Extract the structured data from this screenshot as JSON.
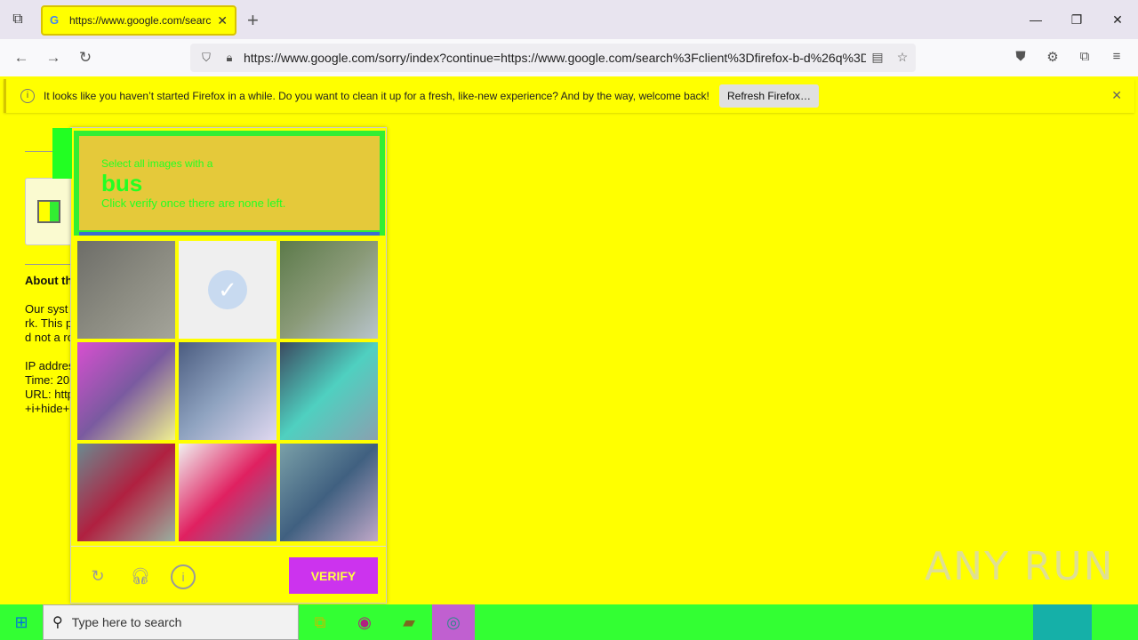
{
  "browser": {
    "tab": {
      "title": "https://www.google.com/search?",
      "favicon_icon": "google-g-icon"
    },
    "url": "https://www.google.com/sorry/index?continue=https://www.google.com/search%3Fclient%3Dfirefox-b-d%26q%3D",
    "notification": {
      "message": "It looks like you haven’t started Firefox in a while. Do you want to clean it up for a fresh, like-new experience? And by the way, welcome back!",
      "button": "Refresh Firefox…"
    }
  },
  "page": {
    "about_heading": "About th",
    "body_lines": [
      "Our syst",
      "rk. This p",
      "d not a ro"
    ],
    "info_lines": [
      "IP addres",
      "Time: 20",
      "URL: http",
      "+i+hide+"
    ]
  },
  "captcha": {
    "instruction_line1": "Select all images with a",
    "target": "bus",
    "instruction_line3": "Click verify once there are none left.",
    "verify_label": "VERIFY",
    "tiles": [
      {
        "row": 0,
        "col": 0,
        "selected": false,
        "palette": [
          "#6d6d68",
          "#8a8a80",
          "#a4a49a"
        ]
      },
      {
        "row": 0,
        "col": 1,
        "selected": true,
        "palette": [
          "#efefef",
          "#efefef",
          "#efefef"
        ]
      },
      {
        "row": 0,
        "col": 2,
        "selected": false,
        "palette": [
          "#5c7a4a",
          "#8a9a78",
          "#b8c4cc"
        ]
      },
      {
        "row": 1,
        "col": 0,
        "selected": false,
        "palette": [
          "#d84fd0",
          "#7a5aa0",
          "#f0f090"
        ]
      },
      {
        "row": 1,
        "col": 1,
        "selected": false,
        "palette": [
          "#4b5c80",
          "#8fa3c0",
          "#e0d8f0"
        ]
      },
      {
        "row": 1,
        "col": 2,
        "selected": false,
        "palette": [
          "#3b4a60",
          "#4fd0c0",
          "#8aa0b0"
        ]
      },
      {
        "row": 2,
        "col": 0,
        "selected": false,
        "palette": [
          "#6a8a90",
          "#b02040",
          "#9ab0a0"
        ]
      },
      {
        "row": 2,
        "col": 1,
        "selected": false,
        "palette": [
          "#f0f0f0",
          "#e02060",
          "#6080a0"
        ]
      },
      {
        "row": 2,
        "col": 2,
        "selected": false,
        "palette": [
          "#7aa0a8",
          "#406080",
          "#c0a8c8"
        ]
      }
    ]
  },
  "watermark": "ANY RUN",
  "taskbar": {
    "search_placeholder": "Type here to search"
  },
  "colors": {
    "page_bg": "#ffff00",
    "accent_green": "#33ff33",
    "verify_bg": "#cc33ee"
  }
}
